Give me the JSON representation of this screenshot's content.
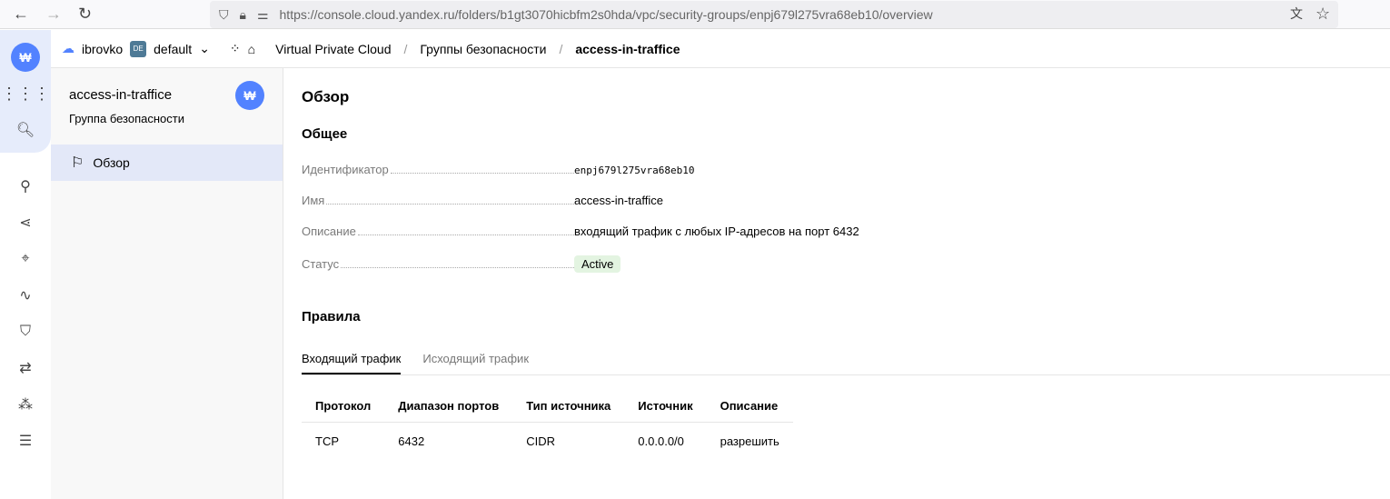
{
  "browser": {
    "url": "https://console.cloud.yandex.ru/folders/b1gt3070hicbfm2s0hda/vpc/security-groups/enpj679l275vra68eb10/overview"
  },
  "header": {
    "cloud": "ibrovko",
    "folder_badge": "DE",
    "folder": "default",
    "breadcrumbs": [
      "Virtual Private Cloud",
      "Группы безопасности",
      "access-in-traffice"
    ]
  },
  "sidebar": {
    "title": "access-in-traffice",
    "subtitle": "Группа безопасности",
    "items": [
      {
        "label": "Обзор"
      }
    ]
  },
  "main": {
    "title": "Обзор",
    "general": "Общее",
    "fields": [
      {
        "key": "Идентификатор",
        "value": "enpj679l275vra68eb10"
      },
      {
        "key": "Имя",
        "value": "access-in-traffice"
      },
      {
        "key": "Описание",
        "value": "входящий трафик с любых IP-адресов на порт 6432"
      },
      {
        "key": "Статус",
        "value": "Active"
      }
    ],
    "rules": "Правила",
    "tabs": [
      "Входящий трафик",
      "Исходящий трафик"
    ],
    "columns": [
      "Протокол",
      "Диапазон портов",
      "Тип источника",
      "Источник",
      "Описание"
    ],
    "rows": [
      [
        "TCP",
        "6432",
        "CIDR",
        "0.0.0.0/0",
        "разрешить"
      ]
    ]
  },
  "colors": {
    "accent": "#5282ff",
    "status": "#2e8a2a"
  }
}
